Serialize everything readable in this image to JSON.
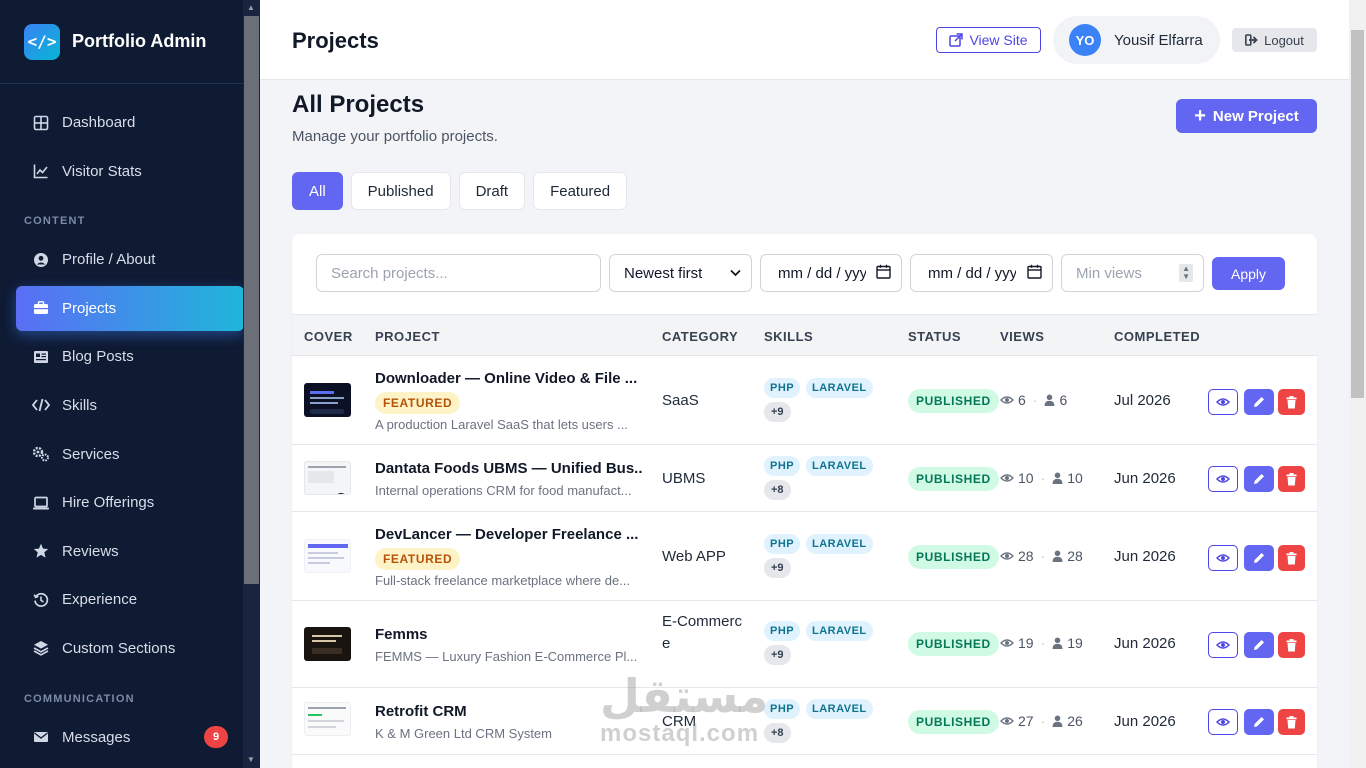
{
  "brand": {
    "title": "Portfolio Admin",
    "logo_text": "</>"
  },
  "sidebar": {
    "items_top": [
      {
        "label": "Dashboard",
        "icon": "grid-icon"
      },
      {
        "label": "Visitor Stats",
        "icon": "chart-line-icon"
      }
    ],
    "section_content": "CONTENT",
    "items_content": [
      {
        "label": "Profile / About",
        "icon": "user-circle-icon"
      },
      {
        "label": "Projects",
        "icon": "briefcase-icon",
        "active": true
      },
      {
        "label": "Blog Posts",
        "icon": "newspaper-icon"
      },
      {
        "label": "Skills",
        "icon": "code-icon"
      },
      {
        "label": "Services",
        "icon": "gears-icon"
      },
      {
        "label": "Hire Offerings",
        "icon": "laptop-icon"
      },
      {
        "label": "Reviews",
        "icon": "star-icon"
      },
      {
        "label": "Experience",
        "icon": "history-icon"
      },
      {
        "label": "Custom Sections",
        "icon": "layers-icon"
      }
    ],
    "section_communication": "COMMUNICATION",
    "items_communication": [
      {
        "label": "Messages",
        "icon": "envelope-icon",
        "badge": "9"
      }
    ]
  },
  "header": {
    "title": "Projects",
    "view_site": "View Site",
    "user_initials": "YO",
    "user_name": "Yousif Elfarra",
    "logout": "Logout"
  },
  "main": {
    "heading": "All Projects",
    "subtitle": "Manage your portfolio projects.",
    "new_project": "New Project",
    "tabs": [
      "All",
      "Published",
      "Draft",
      "Featured"
    ],
    "active_tab": "All",
    "filters": {
      "search_placeholder": "Search projects...",
      "sort_value": "Newest first",
      "date_from": "mm / dd / yyyy",
      "date_to": "mm / dd / yyyy",
      "min_views_placeholder": "Min views",
      "apply": "Apply"
    },
    "columns": [
      "COVER",
      "PROJECT",
      "CATEGORY",
      "SKILLS",
      "STATUS",
      "VIEWS",
      "COMPLETED"
    ],
    "rows": [
      {
        "title": "Downloader — Online Video & File ...",
        "featured": "FEATURED",
        "desc": "A production Laravel SaaS that lets users ...",
        "category": "SaaS",
        "skills": [
          "PHP",
          "LARAVEL"
        ],
        "more": "+9",
        "status": "PUBLISHED",
        "views": "6",
        "visitors": "6",
        "completed": "Jul 2026"
      },
      {
        "title": "Dantata Foods UBMS — Unified Bus...",
        "featured": "",
        "desc": "Internal operations CRM for food manufact...",
        "category": "UBMS",
        "skills": [
          "PHP",
          "LARAVEL"
        ],
        "more": "+8",
        "status": "PUBLISHED",
        "views": "10",
        "visitors": "10",
        "completed": "Jun 2026"
      },
      {
        "title": "DevLancer — Developer Freelance ...",
        "featured": "FEATURED",
        "desc": "Full-stack freelance marketplace where de...",
        "category": "Web APP",
        "skills": [
          "PHP",
          "LARAVEL"
        ],
        "more": "+9",
        "status": "PUBLISHED",
        "views": "28",
        "visitors": "28",
        "completed": "Jun 2026"
      },
      {
        "title": "Femms",
        "featured": "",
        "desc": "FEMMS — Luxury Fashion E-Commerce Pl...",
        "category": "E-Commerce",
        "skills": [
          "PHP",
          "LARAVEL"
        ],
        "more": "+9",
        "status": "PUBLISHED",
        "views": "19",
        "visitors": "19",
        "completed": "Jun 2026"
      },
      {
        "title": "Retrofit CRM",
        "featured": "",
        "desc": "K & M Green Ltd CRM System",
        "category": "CRM",
        "skills": [
          "PHP",
          "LARAVEL"
        ],
        "more": "+8",
        "status": "PUBLISHED",
        "views": "27",
        "visitors": "26",
        "completed": "Jun 2026"
      }
    ]
  },
  "watermark": {
    "arabic": "مستقل",
    "latin": "mostaql.com"
  },
  "colors": {
    "accent": "#6366f1",
    "sidebar_bg": "#0f1a33",
    "danger": "#ef4444",
    "success_bg": "#d1fae5"
  }
}
